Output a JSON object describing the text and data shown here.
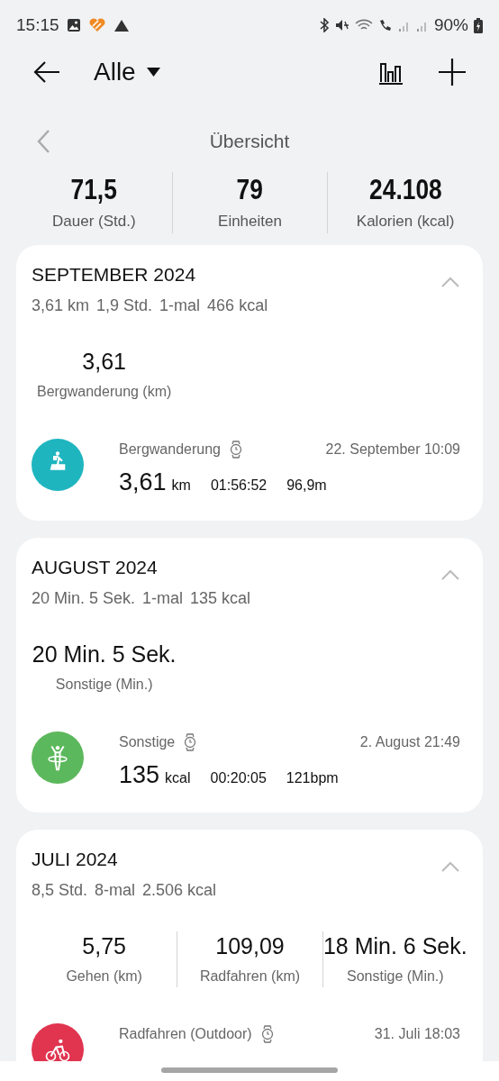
{
  "status_bar": {
    "time": "15:15",
    "battery": "90%"
  },
  "header": {
    "title": "Alle"
  },
  "overview": {
    "title": "Übersicht",
    "stats": [
      {
        "value": "71,5",
        "label": "Dauer (Std.)"
      },
      {
        "value": "79",
        "label": "Einheiten"
      },
      {
        "value": "24.108",
        "label": "Kalorien (kcal)"
      }
    ]
  },
  "months": [
    {
      "title": "SEPTEMBER 2024",
      "summary": [
        "3,61 km",
        "1,9 Std.",
        "1-mal",
        "466 kcal"
      ],
      "expanded": true,
      "totals": [
        {
          "value": "3,61",
          "label": "Bergwanderung (km)"
        }
      ],
      "workouts": [
        {
          "kind": "hiking",
          "color": "#1fb5bf",
          "name": "Bergwanderung",
          "date": "22. September 10:09",
          "value": "3,61",
          "unit": "km",
          "metrics": [
            "01:56:52",
            "96,9m"
          ]
        }
      ]
    },
    {
      "title": "AUGUST 2024",
      "summary": [
        "20 Min. 5 Sek.",
        "1-mal",
        "135 kcal"
      ],
      "expanded": true,
      "totals": [
        {
          "value": "20 Min. 5 Sek.",
          "label": "Sonstige (Min.)"
        }
      ],
      "workouts": [
        {
          "kind": "other",
          "color": "#5cb85c",
          "name": "Sonstige",
          "date": "2. August 21:49",
          "value": "135",
          "unit": "kcal",
          "metrics": [
            "00:20:05",
            "121bpm"
          ]
        }
      ]
    },
    {
      "title": "JULI 2024",
      "summary": [
        "8,5 Std.",
        "8-mal",
        "2.506 kcal"
      ],
      "expanded": true,
      "totals": [
        {
          "value": "5,75",
          "label": "Gehen (km)"
        },
        {
          "value": "109,09",
          "label": "Radfahren (km)"
        },
        {
          "value": "18 Min. 6 Sek.",
          "label": "Sonstige (Min.)"
        }
      ],
      "workouts": [
        {
          "kind": "cycling",
          "color": "#e0344f",
          "name": "Radfahren (Outdoor)",
          "date": "31. Juli 18:03"
        }
      ]
    }
  ]
}
